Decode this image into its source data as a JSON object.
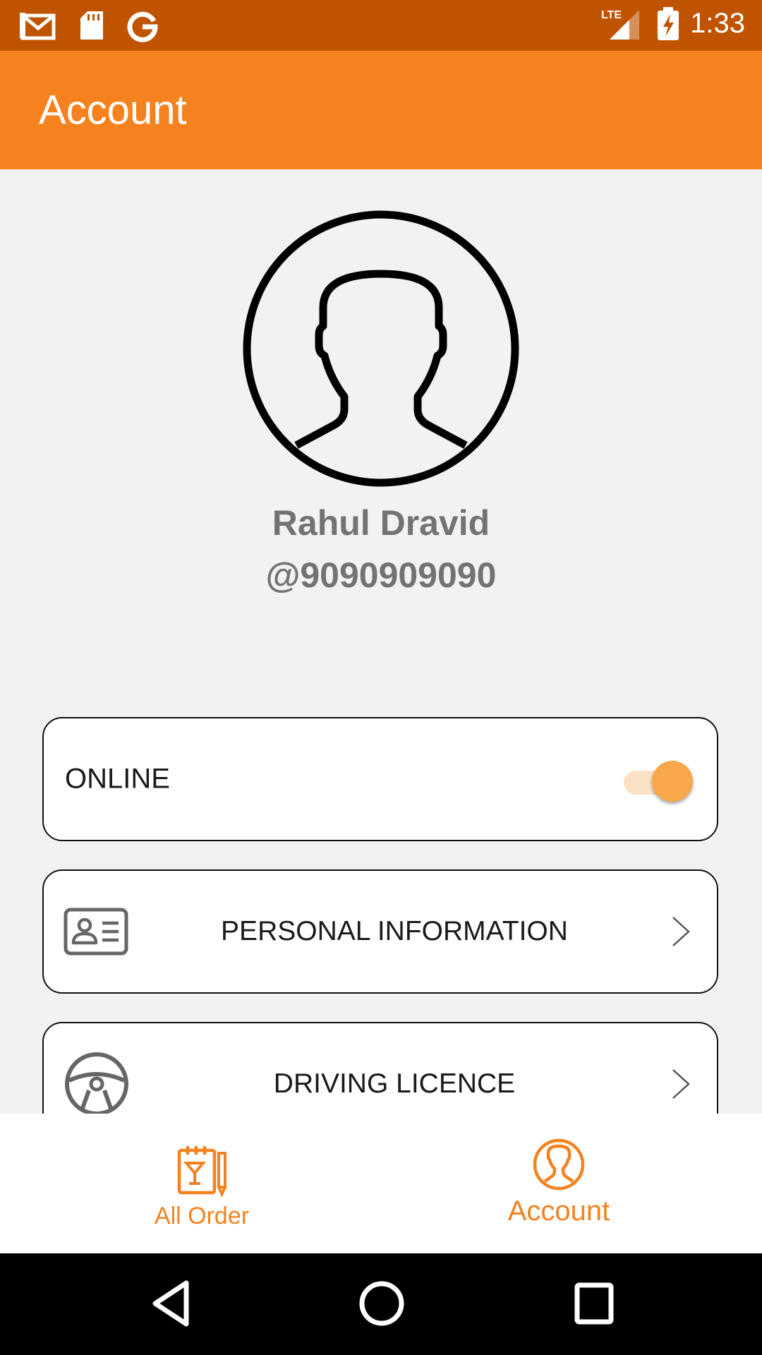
{
  "status_bar": {
    "time": "1:33",
    "network": "LTE",
    "left_icons": [
      "gmail-icon",
      "sd-card-icon",
      "google-icon"
    ],
    "right_icons": [
      "lte-signal-icon",
      "battery-charging-icon"
    ]
  },
  "app_bar": {
    "title": "Account"
  },
  "profile": {
    "name": "Rahul Dravid",
    "phone": "@9090909090"
  },
  "online_card": {
    "label": "ONLINE",
    "toggle_on": true
  },
  "menu": {
    "personal_information": "PERSONAL INFORMATION",
    "driving_licence": "DRIVING LICENCE"
  },
  "bottom_nav": {
    "all_order": "All Order",
    "account": "Account"
  },
  "colors": {
    "status_bar": "#bf5300",
    "app_bar": "#f5821f",
    "accent": "#f5821f",
    "toggle_thumb": "#f8a84a",
    "text_gray": "#737373"
  }
}
